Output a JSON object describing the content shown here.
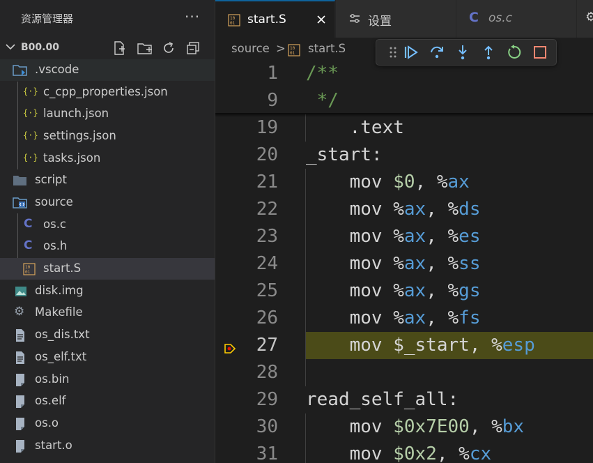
{
  "sidebar": {
    "title": "资源管理器",
    "more": "···",
    "root": "B00.00",
    "items": [
      {
        "label": ".vscode",
        "icon": "vscode-folder-icon",
        "selected": false,
        "hover": true
      },
      {
        "label": "c_cpp_properties.json",
        "icon": "json-icon"
      },
      {
        "label": "launch.json",
        "icon": "json-icon"
      },
      {
        "label": "settings.json",
        "icon": "json-icon"
      },
      {
        "label": "tasks.json",
        "icon": "json-icon"
      },
      {
        "label": "script",
        "icon": "folder-icon"
      },
      {
        "label": "source",
        "icon": "source-folder-icon"
      },
      {
        "label": "os.c",
        "icon": "c-file-icon"
      },
      {
        "label": "os.h",
        "icon": "c-file-icon"
      },
      {
        "label": "start.S",
        "icon": "asm-file-icon",
        "selected": true
      },
      {
        "label": "disk.img",
        "icon": "image-file-icon"
      },
      {
        "label": "Makefile",
        "icon": "makefile-icon"
      },
      {
        "label": "os_dis.txt",
        "icon": "text-file-icon"
      },
      {
        "label": "os_elf.txt",
        "icon": "text-file-icon"
      },
      {
        "label": "os.bin",
        "icon": "binary-file-icon"
      },
      {
        "label": "os.elf",
        "icon": "binary-file-icon"
      },
      {
        "label": "os.o",
        "icon": "binary-file-icon"
      },
      {
        "label": "start.o",
        "icon": "binary-file-icon"
      }
    ]
  },
  "tabs": [
    {
      "label": "start.S",
      "active": true,
      "icon": "asm-file-icon"
    },
    {
      "label": "设置",
      "active": false,
      "icon": "settings-icon"
    },
    {
      "label": "os.c",
      "active": false,
      "icon": "c-file-icon",
      "italic": true
    }
  ],
  "breadcrumb": {
    "folder": "source",
    "sep": ">",
    "file": "start.S"
  },
  "debug_toolbar": [
    "grip-icon",
    "continue-icon",
    "step-over-icon",
    "step-into-icon",
    "step-out-icon",
    "restart-icon",
    "stop-icon"
  ],
  "editor": {
    "sticky": [
      {
        "num": "1",
        "text": "/**"
      },
      {
        "num": "9",
        "text": " */"
      }
    ],
    "lines": [
      {
        "num": "19",
        "text": "    .text"
      },
      {
        "num": "20",
        "text": "_start:"
      },
      {
        "num": "21",
        "text": "    mov $0, %ax"
      },
      {
        "num": "22",
        "text": "    mov %ax, %ds"
      },
      {
        "num": "23",
        "text": "    mov %ax, %es"
      },
      {
        "num": "24",
        "text": "    mov %ax, %ss"
      },
      {
        "num": "25",
        "text": "    mov %ax, %gs"
      },
      {
        "num": "26",
        "text": "    mov %ax, %fs"
      },
      {
        "num": "27",
        "text": "    mov $_start, %esp",
        "current": true
      },
      {
        "num": "28",
        "text": ""
      },
      {
        "num": "29",
        "text": "read_self_all:"
      },
      {
        "num": "30",
        "text": "    mov $0x7E00, %bx"
      },
      {
        "num": "31",
        "text": "    mov $0x2, %cx"
      }
    ]
  },
  "colors": {
    "accent": "#0e639c",
    "current_line": "#4b4b18",
    "debug_arrow": "#ffcc00"
  }
}
